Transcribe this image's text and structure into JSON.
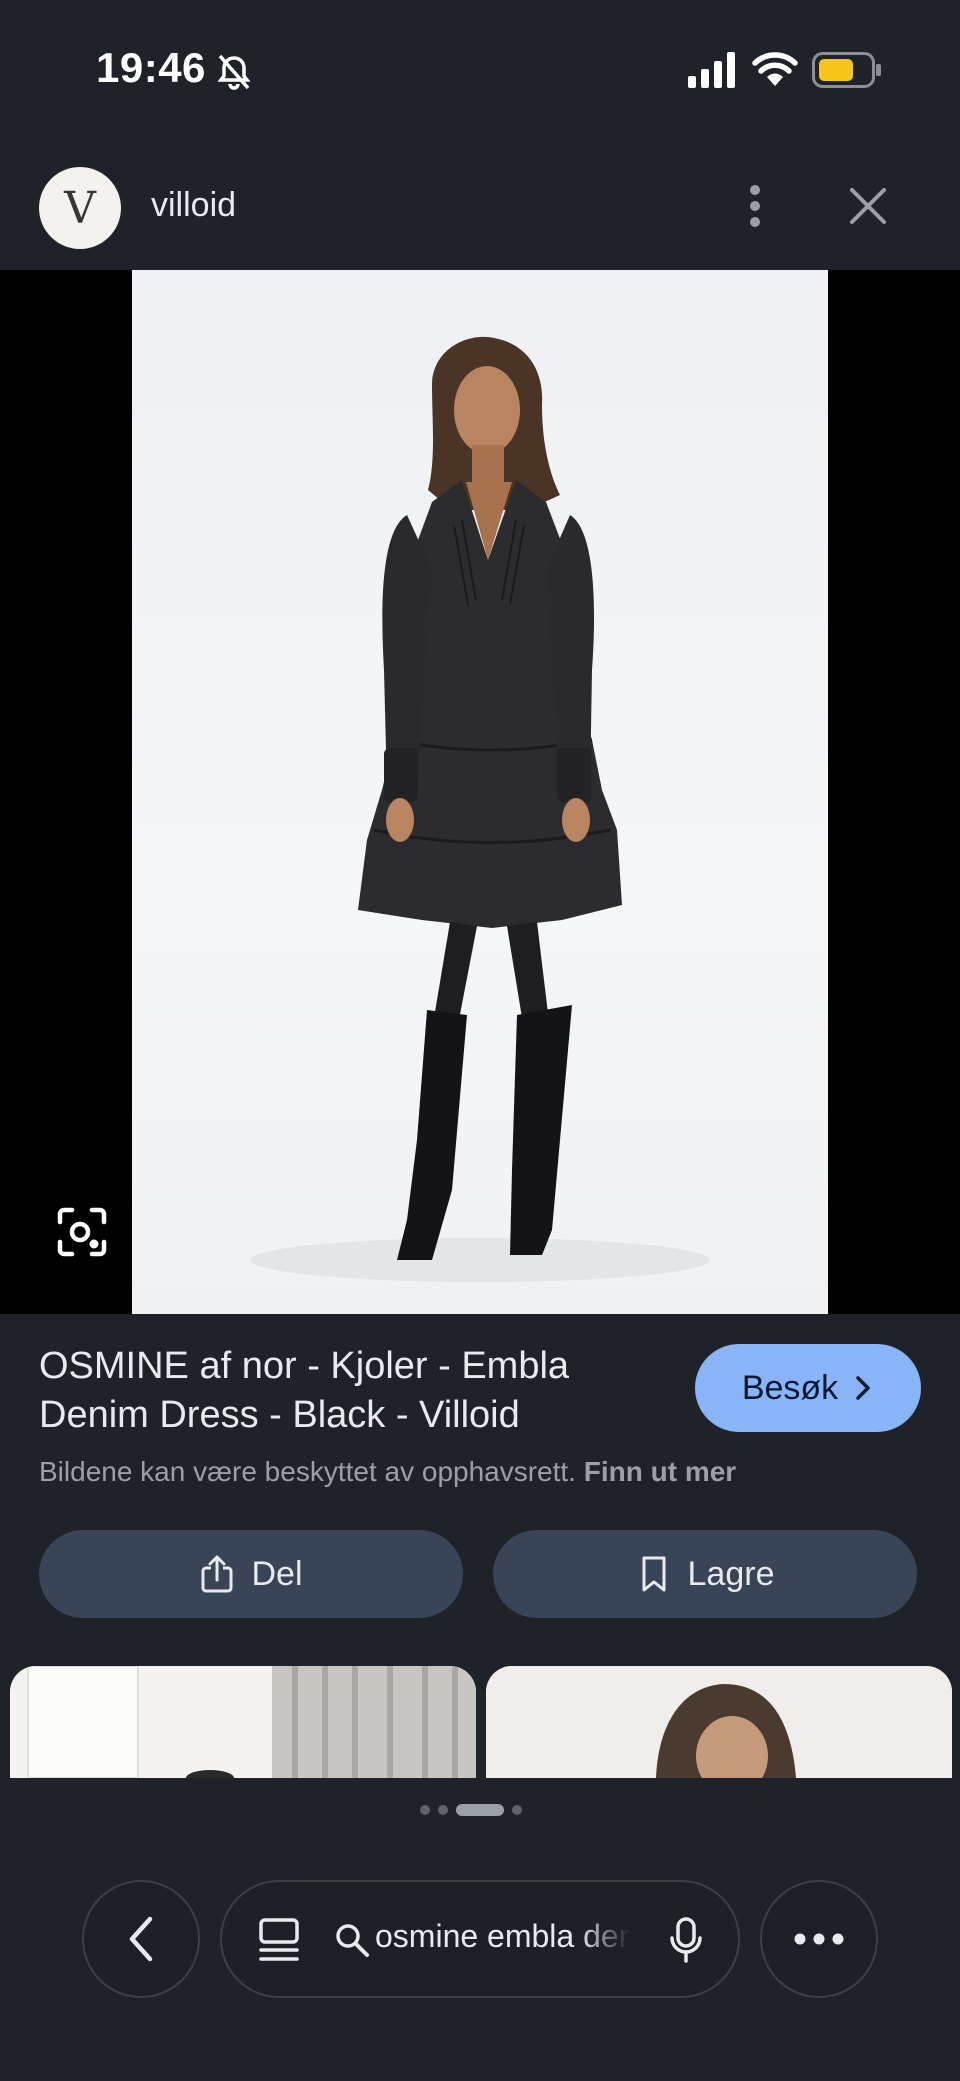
{
  "status_bar": {
    "time": "19:46",
    "battery_color": "#f5c518"
  },
  "header": {
    "site_logo_letter": "V",
    "site_name": "villoid"
  },
  "result": {
    "title": "OSMINE af nor - Kjoler - Embla Denim Dress - Black - Villoid",
    "visit_label": "Besøk",
    "copyright_text": "Bildene kan være beskyttet av opphavsrett.",
    "learn_more": "Finn ut mer"
  },
  "actions": {
    "share_label": "Del",
    "save_label": "Lagre"
  },
  "pager": {
    "count": 4,
    "active_index": 2
  },
  "bottom_nav": {
    "search_query": "osmine embla denim dress"
  },
  "colors": {
    "background": "#202229",
    "accent": "#8ab4f8",
    "button_bg": "#394457"
  }
}
